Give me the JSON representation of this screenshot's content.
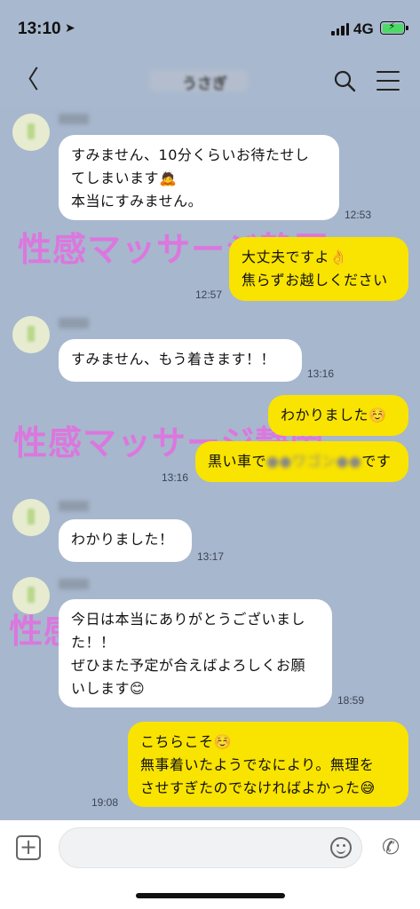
{
  "status": {
    "time": "13:10",
    "network": "4G",
    "battery_charging": true,
    "battery_level": 1.0
  },
  "header": {
    "title": "うさぎ"
  },
  "messages": [
    {
      "side": "in",
      "text": "すみません、10分くらいお待たせし\nてしまいます🙇\n本当にすみません。",
      "time": "12:53"
    },
    {
      "side": "out",
      "text": "大丈夫ですよ👌\n焦らずお越しください",
      "time": "12:57"
    },
    {
      "side": "in",
      "text": "すみません、もう着きます！！",
      "time": "13:16"
    },
    {
      "side": "out",
      "text": "わかりました☺️",
      "time": ""
    },
    {
      "side": "out",
      "text_before": "黒い車で",
      "text_blurred": "●●ワゴン●●",
      "text_after": "です",
      "time": "13:16"
    },
    {
      "side": "in",
      "text": "わかりました！",
      "time": "13:17"
    },
    {
      "side": "in",
      "text": "今日は本当にありがとうございまし\nた！！\nぜひまた予定が合えばよろしくお願\nいします😊",
      "time": "18:59"
    },
    {
      "side": "out",
      "text": "こちらこそ☺️\n無事着いたようでなにより。無理を\nさせすぎたのでなければよかった😅",
      "time": "19:08"
    }
  ],
  "watermark": "性感マッサージ静岡",
  "icons": {
    "back": "chevron-left-icon",
    "search": "search-icon",
    "menu": "hamburger-menu-icon",
    "plus": "plus-icon",
    "emoji": "smiley-icon",
    "phone": "phone-icon"
  },
  "colors": {
    "background": "#a7b7cd",
    "incoming_bubble": "#ffffff",
    "outgoing_bubble": "#f9e300",
    "watermark": "#f25ce6"
  }
}
